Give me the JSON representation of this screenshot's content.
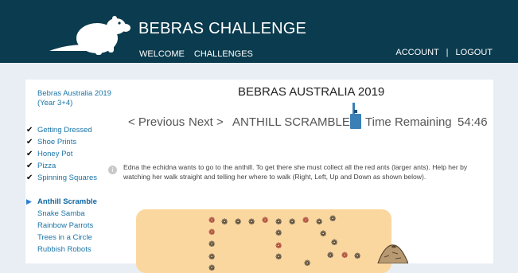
{
  "header": {
    "brand": "BEBRAS CHALLENGE",
    "nav_left": [
      "WELCOME",
      "CHALLENGES"
    ],
    "account": "ACCOUNT",
    "separator": "|",
    "logout": "LOGOUT"
  },
  "sidebar": {
    "competition": "Bebras Australia 2019 (Year 3+4)",
    "completed": [
      "Getting Dressed",
      "Shoe Prints",
      "Honey Pot",
      "Pizza",
      "Spinning Squares"
    ],
    "current": "Anthill Scramble",
    "remaining": [
      "Snake Samba",
      "Rainbow Parrots",
      "Trees in a Circle",
      "Rubbish Robots"
    ]
  },
  "main": {
    "title": "BEBRAS AUSTRALIA 2019",
    "prev": "< Previous",
    "next": "Next >",
    "task_title": "ANTHILL SCRAMBLE",
    "time_label": "Time Remaining",
    "time_value": "54:46",
    "info_icon": "i",
    "description": "Edna the echidna wants to go to the anthill. To get there she must collect all the red ants (larger ants). Help her by watching her walk straight and telling her where to walk (Right, Left, Up and Down as shown below)."
  },
  "icons": {
    "logo": "beaver-logo-icon",
    "flag": "bookmark-flag-icon",
    "check": "check-icon",
    "arrow": "play-arrow-icon",
    "info": "info-icon",
    "ant": "ant-icon",
    "anthill": "anthill-icon"
  },
  "colors": {
    "header_bg": "#0b3b4e",
    "page_bg": "#e9eef4",
    "link": "#1a74a6",
    "board": "#fbd7a0",
    "red_ant": "#8a1414",
    "flag": "#3a7fb6"
  }
}
